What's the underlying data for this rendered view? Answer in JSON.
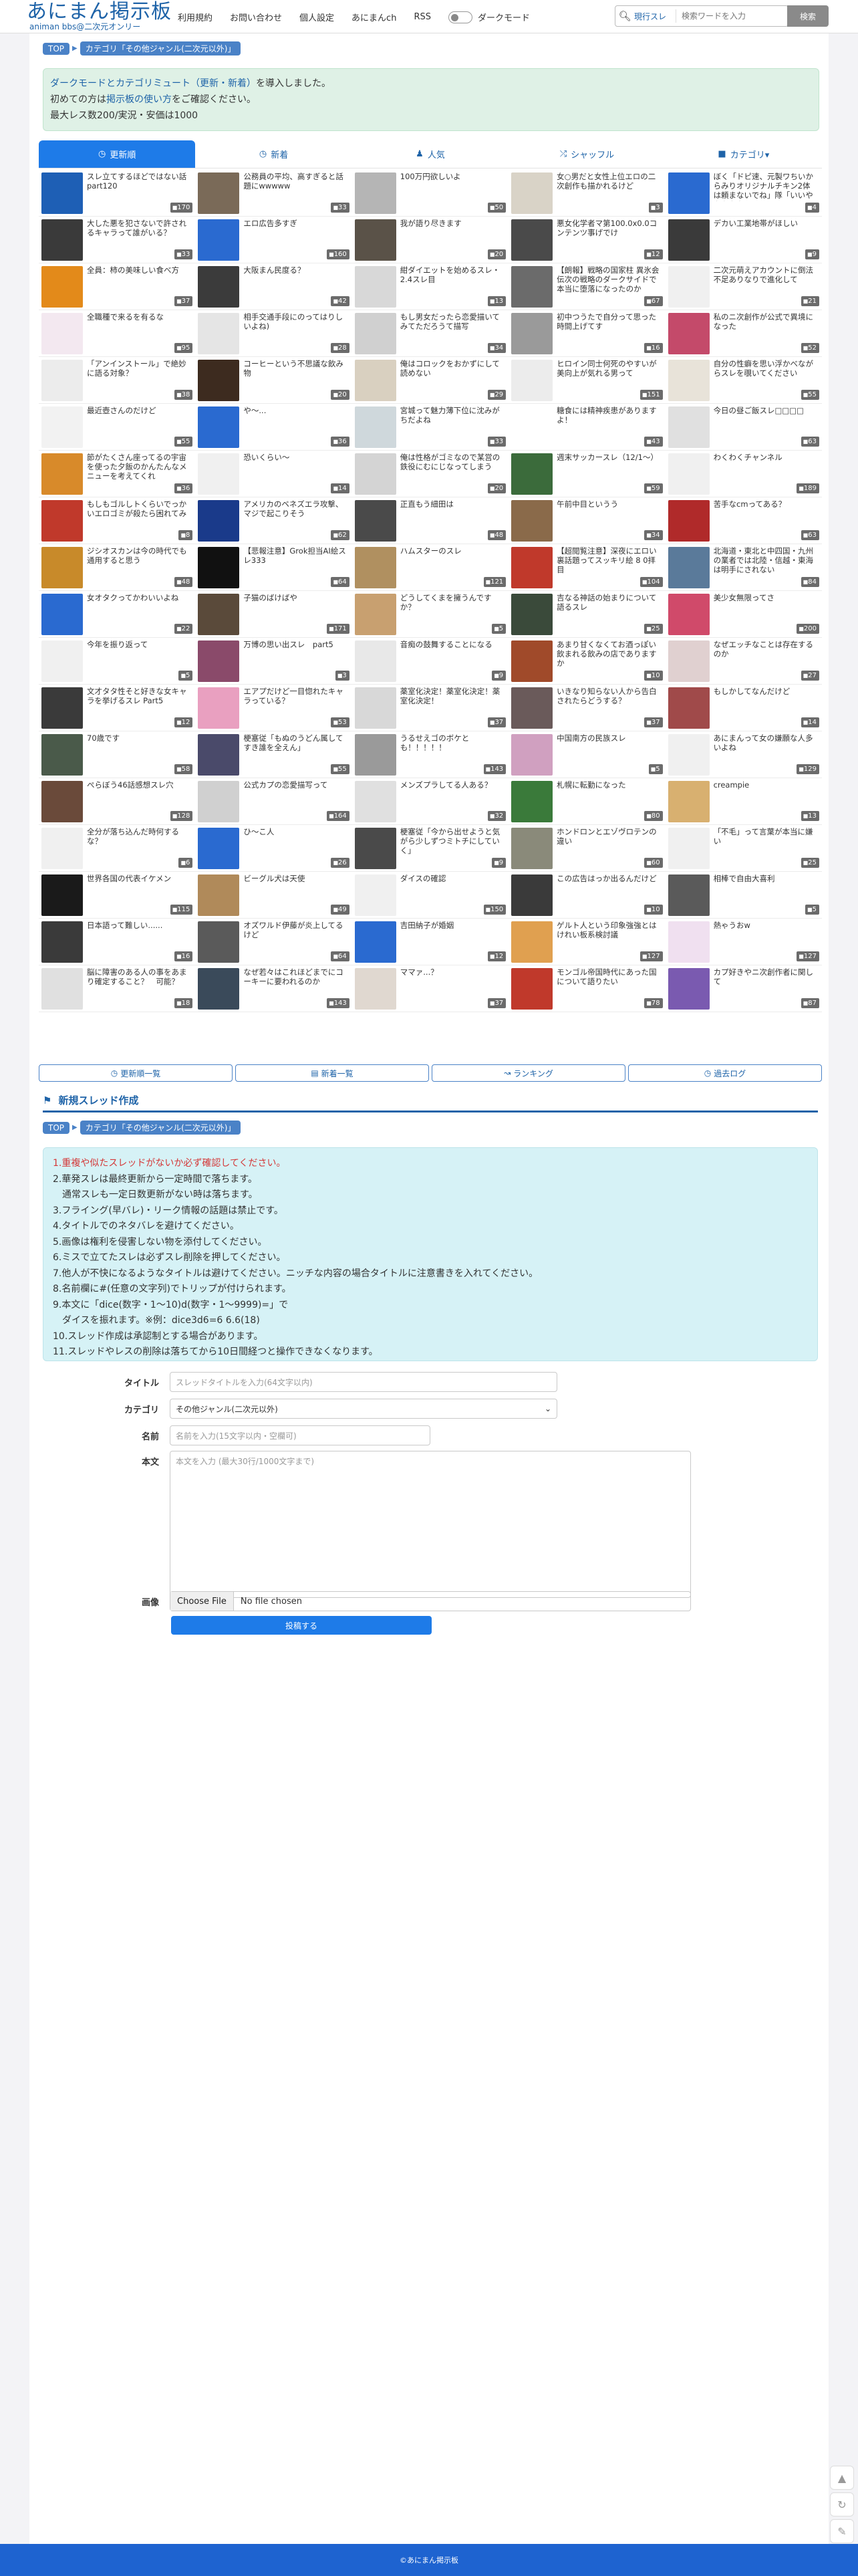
{
  "header": {
    "logo_title": "あにまん掲示板",
    "logo_sub": "animan bbs@二次元オンリー",
    "nav": [
      "利用規約",
      "お問い合わせ",
      "個人設定",
      "あにまんch",
      "RSS"
    ],
    "dark_mode_label": "ダークモード",
    "search_scope": "現行スレ",
    "search_placeholder": "検索ワードを入力",
    "search_button": "検索"
  },
  "breadcrumb": {
    "top": "TOP",
    "category": "カテゴリ「その他ジャンル(二次元以外)」"
  },
  "notice": {
    "line1_link": "ダークモードとカテゴリミュート（更新・新着）",
    "line1_text": "を導入しました。",
    "line2_prefix": "初めての方は",
    "line2_link": "掲示板の使い方",
    "line2_suffix": "をご確認ください。",
    "line3": "最大レス数200/実況・安価は1000"
  },
  "tabs": [
    {
      "label": "更新順",
      "icon": "clock-icon"
    },
    {
      "label": "新着",
      "icon": "history-icon"
    },
    {
      "label": "人気",
      "icon": "person-icon"
    },
    {
      "label": "シャッフル",
      "icon": "shuffle-icon"
    },
    {
      "label": "カテゴリ▾",
      "icon": "folder-icon"
    }
  ],
  "threads": [
    {
      "title": "スレ立てするほどではない話part120",
      "count": "170",
      "color": "#1e5fb5"
    },
    {
      "title": "公務員の平均、高すぎると話題にwwwww",
      "count": "33",
      "color": "#7a6a58"
    },
    {
      "title": "100万円欲しいよ",
      "count": "50",
      "color": "#b5b5b5"
    },
    {
      "title": "女○男だと女性上位エロの二次創作も描かれるけど",
      "count": "3",
      "color": "#d9d3c7"
    },
    {
      "title": "ぼく「ドピ速、元製ワちいからみりオリジナルチキン2体は頼まないでね」隊「いいやああああ」",
      "count": "4",
      "color": "#2a6ad0"
    },
    {
      "title": "大した悪を犯さないで許されるキャラって誰がいる？",
      "count": "33",
      "color": "#3a3a3a"
    },
    {
      "title": "エロ広告多すぎ",
      "count": "160",
      "color": "#2a6ad0"
    },
    {
      "title": "我が語り尽きます",
      "count": "20",
      "color": "#5a5248"
    },
    {
      "title": "悪女化学者マ第100.0x0.0コンテンツ事げでけ",
      "count": "12",
      "color": "#4a4a4a"
    },
    {
      "title": "デカい工業地帯がほしい",
      "count": "9",
      "color": "#3a3a3a"
    },
    {
      "title": "全員：柿の美味しい食べ方",
      "count": "37",
      "color": "#e38a1a"
    },
    {
      "title": "大阪まん民度る？",
      "count": "42",
      "color": "#3b3b3b"
    },
    {
      "title": "紺ダイエットを始めるスレ・2.4スレ目",
      "count": "13",
      "color": "#d8d8d8"
    },
    {
      "title": "【朗報】戦略の国家柱 異氷会伝次の戦略のダークサイドで本当に堕落になったのか",
      "count": "67",
      "color": "#6b6b6b"
    },
    {
      "title": "二次元萌えアカウントに倒法不足ありなりで進化して",
      "count": "21",
      "color": "#f0f0f0"
    },
    {
      "title": "全職種で来るを有るな",
      "count": "95",
      "color": "#f3e8f0"
    },
    {
      "title": "相手交通手段にのってはりしいよね)",
      "count": "28",
      "color": "#e5e5e5"
    },
    {
      "title": "もし男女だったら恋愛描いてみてただろうて描写",
      "count": "34",
      "color": "#d0d0d0"
    },
    {
      "title": "初中つうたで自分って思った時間上げてす",
      "count": "16",
      "color": "#9a9a9a"
    },
    {
      "title": "私のニ次創作が公式で異境になった",
      "count": "52",
      "color": "#c44a6a"
    },
    {
      "title": "「アンインストール」で絶妙に語る対象？",
      "count": "38",
      "color": "#ececec"
    },
    {
      "title": "コーヒーという不思議な飲み物",
      "count": "20",
      "color": "#3d2b1f"
    },
    {
      "title": "俺はコロックをおかずにして読めない",
      "count": "29",
      "color": "#d9d0c0"
    },
    {
      "title": "ヒロイン同士何死のやすいが美向上が気れる男って",
      "count": "151",
      "color": "#ececec"
    },
    {
      "title": "自分の性癖を思い浮かべながらスレを覗いてください",
      "count": "55",
      "color": "#e8e3d9"
    },
    {
      "title": "最近壺さんのだけど",
      "count": "55",
      "color": "#f2f2f2"
    },
    {
      "title": "や〜...",
      "count": "36",
      "color": "#2a6ad0"
    },
    {
      "title": "宮城って魅力薄下位に沈みがちだよね",
      "count": "33",
      "color": "#cfd8dc"
    },
    {
      "title": "糖食には精神疾患がありますよ！",
      "count": "43",
      "color": "#ffffff"
    },
    {
      "title": "今日の昼ご飯スレ□□□□",
      "count": "63",
      "color": "#e0e0e0"
    },
    {
      "title": "節がたくさん座ってるの宇宙を使った夕飯のかんたんなメニューを考えてくれ",
      "count": "36",
      "color": "#d88a2a"
    },
    {
      "title": "恐いくらい〜",
      "count": "14",
      "color": "#f0f0f0"
    },
    {
      "title": "俺は性格がゴミなので某営の鉄役にむにじなってしまう",
      "count": "20",
      "color": "#d4d4d4"
    },
    {
      "title": "週末サッカースレ（12/1〜）",
      "count": "59",
      "color": "#3b6b3b"
    },
    {
      "title": "わくわくチャンネル",
      "count": "189",
      "color": "#f0f0f0"
    },
    {
      "title": "もしもゴルしトくらいでっかいエロゴミが殺たら困れてみ",
      "count": "8",
      "color": "#c0392b"
    },
    {
      "title": "アメリカのベネズエラ攻撃、マジで起こりそう",
      "count": "62",
      "color": "#1a3a8a"
    },
    {
      "title": "正直もう細田は",
      "count": "48",
      "color": "#4a4a4a"
    },
    {
      "title": "午前中目というう",
      "count": "34",
      "color": "#8a6a4a"
    },
    {
      "title": "苦手なcmってある？",
      "count": "63",
      "color": "#b02a2a"
    },
    {
      "title": "ジシオスカンは今の時代でも通用すると思う",
      "count": "48",
      "color": "#c88a2a"
    },
    {
      "title": "【悲報注意】Grok担当AI絵スレ333",
      "count": "64",
      "color": "#111111"
    },
    {
      "title": "ハムスターのスレ",
      "count": "121",
      "color": "#b09060"
    },
    {
      "title": "【超閲覧注意】深夜にエロい裏話題ってスッキリ絵 8 0拝目",
      "count": "104",
      "color": "#c0392b"
    },
    {
      "title": "北海道・東北と中四国・九州の業者では北陸・信越・東海は明手にされない",
      "count": "84",
      "color": "#5a7a9a"
    },
    {
      "title": "女オタクってかわいいよね",
      "count": "22",
      "color": "#2a6ad0"
    },
    {
      "title": "子猫のばけばや",
      "count": "171",
      "color": "#5a4a3a"
    },
    {
      "title": "どうしてくまを擁うんですか？",
      "count": "5",
      "color": "#c8a070"
    },
    {
      "title": "吉なる神話の始まりについて語るスレ",
      "count": "25",
      "color": "#3a4a3a"
    },
    {
      "title": "美少女無限ってさ",
      "count": "200",
      "color": "#d04a6a"
    },
    {
      "title": "今年を振り返って",
      "count": "5",
      "color": "#f0f0f0"
    },
    {
      "title": "万博の思い出スレ　part5",
      "count": "3",
      "color": "#8a4a6a"
    },
    {
      "title": "音痴の鼓舞することになる",
      "count": "9",
      "color": "#e8e8e8"
    },
    {
      "title": "あまり甘くなくてお酒っぽい飲まれる飲みの店でありますか",
      "count": "10",
      "color": "#a04a2a"
    },
    {
      "title": "なぜエッチなことは存在するのか",
      "count": "27",
      "color": "#e0d0d0"
    },
    {
      "title": "文才タタ性そと好きな女キャラを挙げるスレ Part5",
      "count": "12",
      "color": "#3a3a3a"
    },
    {
      "title": "エアプだけど一目惚れたキャラっている？",
      "count": "53",
      "color": "#e9a0c0"
    },
    {
      "title": "薬室化決定！薬室化決定！薬室化決定！",
      "count": "37",
      "color": "#d8d8d8"
    },
    {
      "title": "いきなり知らない人から告白されたらどうする？",
      "count": "37",
      "color": "#6a5a5a"
    },
    {
      "title": "もしかしてなんだけど",
      "count": "14",
      "color": "#a04a4a"
    },
    {
      "title": "70歳です",
      "count": "58",
      "color": "#4a5a4a"
    },
    {
      "title": "梗塞従「もぬのうどん属してすき誰を全えん」",
      "count": "55",
      "color": "#4a4a6a"
    },
    {
      "title": "うるせえゴのボケとも！！！！！",
      "count": "143",
      "color": "#9a9a9a"
    },
    {
      "title": "中国南方の民族スレ",
      "count": "5",
      "color": "#d0a0c0"
    },
    {
      "title": "あにまんって女の嫌願な人多いよね",
      "count": "129",
      "color": "#f0f0f0"
    },
    {
      "title": "ぺらぼう46話感想スレ穴",
      "count": "128",
      "color": "#6a4a3a"
    },
    {
      "title": "公式カプの恋愛描写って",
      "count": "164",
      "color": "#d0d0d0"
    },
    {
      "title": "メンズプラしてる人ある？",
      "count": "32",
      "color": "#e0e0e0"
    },
    {
      "title": "札幌に転勤になった",
      "count": "80",
      "color": "#3a7a3a"
    },
    {
      "title": "creampie",
      "count": "13",
      "color": "#d8b070"
    },
    {
      "title": "全分が落ち込んだ時何するな？",
      "count": "6",
      "color": "#f0f0f0"
    },
    {
      "title": "ひ〜こ人",
      "count": "26",
      "color": "#2a6ad0"
    },
    {
      "title": "梗塞従「今から出せようと気がら少しずつミトチにしていく」",
      "count": "9",
      "color": "#4a4a4a"
    },
    {
      "title": "ホンドロンとエゾヴロテンの違い",
      "count": "60",
      "color": "#8a8a7a"
    },
    {
      "title": "「不毛」って言葉が本当に嫌い",
      "count": "25",
      "color": "#f0f0f0"
    },
    {
      "title": "世界各国の代表イケメン",
      "count": "115",
      "color": "#1a1a1a"
    },
    {
      "title": "ビーグル犬は天使",
      "count": "49",
      "color": "#b08a5a"
    },
    {
      "title": "ダイスの確認",
      "count": "150",
      "color": "#f0f0f0"
    },
    {
      "title": "この広告はっか出るんだけど",
      "count": "10",
      "color": "#3a3a3a"
    },
    {
      "title": "相棒で自由大喜利",
      "count": "5",
      "color": "#5a5a5a"
    },
    {
      "title": "日本語って難しい......",
      "count": "16",
      "color": "#3a3a3a"
    },
    {
      "title": "オズワルド伊藤が炎上してるけど",
      "count": "64",
      "color": "#5a5a5a"
    },
    {
      "title": "吉田納子が婚姻",
      "count": "12",
      "color": "#2a6ad0"
    },
    {
      "title": "ゲルト人という印象強強とはけれい板系検討議",
      "count": "127",
      "color": "#e0a050"
    },
    {
      "title": "熱ゃうおw",
      "count": "127",
      "color": "#f0e0f0"
    },
    {
      "title": "脳に障害のある人の事をあまり確定すること？　可能？",
      "count": "18",
      "color": "#e0e0e0"
    },
    {
      "title": "なぜ若々はこれほどまでにコーキーに要われるのか",
      "count": "143",
      "color": "#3a4a5a"
    },
    {
      "title": "ママァ...？",
      "count": "37",
      "color": "#e0d8d0"
    },
    {
      "title": "モンゴル帝国時代にあった国について語りたい",
      "count": "78",
      "color": "#c0392b"
    },
    {
      "title": "カプ好きやニ次創作者に関して",
      "count": "87",
      "color": "#7a5ab0"
    }
  ],
  "bottom_nav": [
    {
      "label": "更新順一覧",
      "icon": "clock-icon"
    },
    {
      "label": "新着一覧",
      "icon": "list-icon"
    },
    {
      "label": "ランキング",
      "icon": "chart-icon"
    },
    {
      "label": "過去ログ",
      "icon": "history-icon"
    }
  ],
  "new_thread": {
    "heading": "新規スレッド作成",
    "rules": [
      "1.重複や似たスレッドがないか必ず確認してください。",
      "2.華発スレは最終更新から一定時間で落ちます。",
      "　通常スレも一定日数更新がない時は落ちます。",
      "3.フライング(早バレ)・リーク情報の話題は禁止です。",
      "4.タイトルでのネタバレを避けてください。",
      "5.画像は権利を侵害しない物を添付してください。",
      "6.ミスで立てたスレは必ずスレ削除を押してください。",
      "7.他人が不快になるようなタイトルは避けてください。ニッチな内容の場合タイトルに注意書きを入れてください。",
      "8.名前欄に#(任意の文字列)でトリップが付けられます。",
      "9.本文に「dice(数字・1〜10)d(数字・1〜9999)=」で",
      "　ダイスを振れます。※例：dice3d6=6 6.6(18)",
      "10.スレッド作成は承認制とする場合があります。",
      "11.スレッドやレスの削除は落ちてから10日間経つと操作できなくなります。"
    ],
    "labels": {
      "title": "タイトル",
      "category": "カテゴリ",
      "name": "名前",
      "body": "本文",
      "image": "画像"
    },
    "title_placeholder": "スレッドタイトルを入力(64文字以内)",
    "category_value": "その他ジャンル(二次元以外)",
    "name_placeholder": "名前を入力(15文字以内・空欄可)",
    "body_placeholder": "本文を入力 (最大30行/1000文字まで)",
    "file_button": "Choose File",
    "file_text": "No file chosen",
    "submit": "投稿する"
  },
  "footer": "©あにまん掲示板"
}
